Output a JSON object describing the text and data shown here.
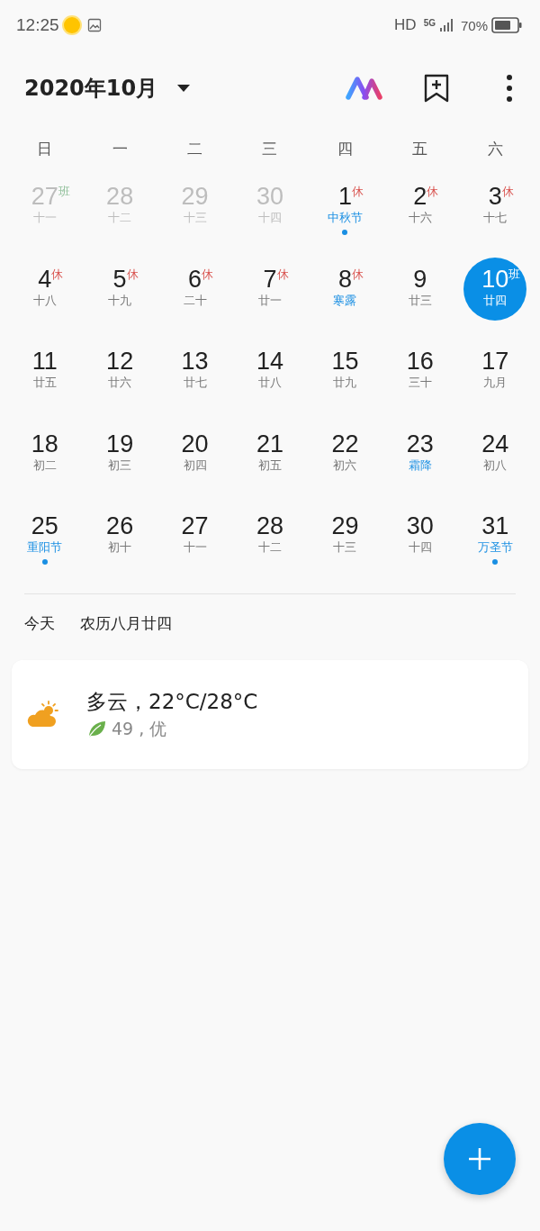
{
  "status_bar": {
    "time": "12:25",
    "network": "HD",
    "signal_label": "5G",
    "battery": "70%"
  },
  "header": {
    "title": "2020年10月"
  },
  "weekdays": [
    "日",
    "一",
    "二",
    "三",
    "四",
    "五",
    "六"
  ],
  "days": [
    {
      "day": "27",
      "lunar": "十一",
      "mark": "班",
      "rest": false,
      "outside": true,
      "festival": false,
      "dot": false,
      "selected": false
    },
    {
      "day": "28",
      "lunar": "十二",
      "outside": true,
      "festival": false,
      "dot": false,
      "selected": false
    },
    {
      "day": "29",
      "lunar": "十三",
      "outside": true,
      "festival": false,
      "dot": false,
      "selected": false
    },
    {
      "day": "30",
      "lunar": "十四",
      "outside": true,
      "festival": false,
      "dot": false,
      "selected": false
    },
    {
      "day": "1",
      "lunar": "中秋节",
      "mark": "休",
      "rest": true,
      "outside": false,
      "festival": true,
      "dot": true,
      "selected": false
    },
    {
      "day": "2",
      "lunar": "十六",
      "mark": "休",
      "rest": true,
      "outside": false,
      "festival": false,
      "dot": false,
      "selected": false
    },
    {
      "day": "3",
      "lunar": "十七",
      "mark": "休",
      "rest": true,
      "outside": false,
      "festival": false,
      "dot": false,
      "selected": false
    },
    {
      "day": "4",
      "lunar": "十八",
      "mark": "休",
      "rest": true,
      "outside": false,
      "festival": false,
      "dot": false,
      "selected": false
    },
    {
      "day": "5",
      "lunar": "十九",
      "mark": "休",
      "rest": true,
      "outside": false,
      "festival": false,
      "dot": false,
      "selected": false
    },
    {
      "day": "6",
      "lunar": "二十",
      "mark": "休",
      "rest": true,
      "outside": false,
      "festival": false,
      "dot": false,
      "selected": false
    },
    {
      "day": "7",
      "lunar": "廿一",
      "mark": "休",
      "rest": true,
      "outside": false,
      "festival": false,
      "dot": false,
      "selected": false
    },
    {
      "day": "8",
      "lunar": "寒露",
      "mark": "休",
      "rest": true,
      "outside": false,
      "festival": true,
      "dot": false,
      "selected": false
    },
    {
      "day": "9",
      "lunar": "廿三",
      "outside": false,
      "festival": false,
      "dot": false,
      "selected": false
    },
    {
      "day": "10",
      "lunar": "廿四",
      "mark": "班",
      "rest": false,
      "outside": false,
      "festival": false,
      "dot": false,
      "selected": true
    },
    {
      "day": "11",
      "lunar": "廿五",
      "outside": false,
      "festival": false,
      "dot": false,
      "selected": false
    },
    {
      "day": "12",
      "lunar": "廿六",
      "outside": false,
      "festival": false,
      "dot": false,
      "selected": false
    },
    {
      "day": "13",
      "lunar": "廿七",
      "outside": false,
      "festival": false,
      "dot": false,
      "selected": false
    },
    {
      "day": "14",
      "lunar": "廿八",
      "outside": false,
      "festival": false,
      "dot": false,
      "selected": false
    },
    {
      "day": "15",
      "lunar": "廿九",
      "outside": false,
      "festival": false,
      "dot": false,
      "selected": false
    },
    {
      "day": "16",
      "lunar": "三十",
      "outside": false,
      "festival": false,
      "dot": false,
      "selected": false
    },
    {
      "day": "17",
      "lunar": "九月",
      "outside": false,
      "festival": false,
      "dot": false,
      "selected": false
    },
    {
      "day": "18",
      "lunar": "初二",
      "outside": false,
      "festival": false,
      "dot": false,
      "selected": false
    },
    {
      "day": "19",
      "lunar": "初三",
      "outside": false,
      "festival": false,
      "dot": false,
      "selected": false
    },
    {
      "day": "20",
      "lunar": "初四",
      "outside": false,
      "festival": false,
      "dot": false,
      "selected": false
    },
    {
      "day": "21",
      "lunar": "初五",
      "outside": false,
      "festival": false,
      "dot": false,
      "selected": false
    },
    {
      "day": "22",
      "lunar": "初六",
      "outside": false,
      "festival": false,
      "dot": false,
      "selected": false
    },
    {
      "day": "23",
      "lunar": "霜降",
      "outside": false,
      "festival": true,
      "dot": false,
      "selected": false
    },
    {
      "day": "24",
      "lunar": "初八",
      "outside": false,
      "festival": false,
      "dot": false,
      "selected": false
    },
    {
      "day": "25",
      "lunar": "重阳节",
      "outside": false,
      "festival": true,
      "dot": true,
      "selected": false
    },
    {
      "day": "26",
      "lunar": "初十",
      "outside": false,
      "festival": false,
      "dot": false,
      "selected": false
    },
    {
      "day": "27",
      "lunar": "十一",
      "outside": false,
      "festival": false,
      "dot": false,
      "selected": false
    },
    {
      "day": "28",
      "lunar": "十二",
      "outside": false,
      "festival": false,
      "dot": false,
      "selected": false
    },
    {
      "day": "29",
      "lunar": "十三",
      "outside": false,
      "festival": false,
      "dot": false,
      "selected": false
    },
    {
      "day": "30",
      "lunar": "十四",
      "outside": false,
      "festival": false,
      "dot": false,
      "selected": false
    },
    {
      "day": "31",
      "lunar": "万圣节",
      "outside": false,
      "festival": true,
      "dot": true,
      "selected": false
    }
  ],
  "today": {
    "label": "今天",
    "lunar_date": "农历八月廿四"
  },
  "weather": {
    "condition": "多云，22°C/28°C",
    "air_quality": "49 , 优"
  }
}
